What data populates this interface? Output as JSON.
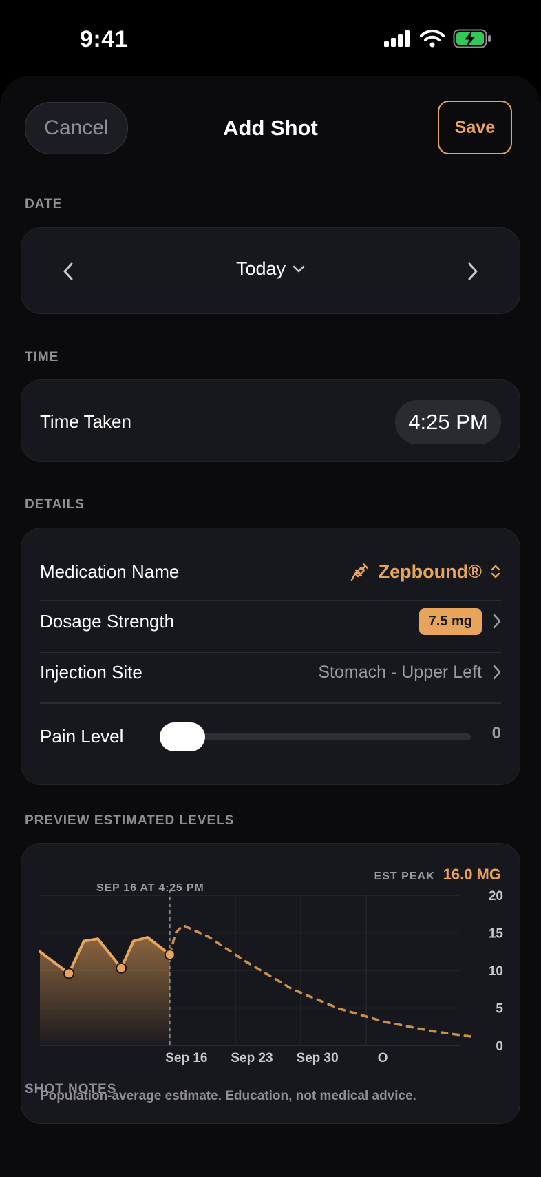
{
  "status": {
    "time": "9:41"
  },
  "nav": {
    "cancel": "Cancel",
    "title": "Add Shot",
    "save": "Save"
  },
  "sections": {
    "date": "DATE",
    "time": "TIME",
    "details": "DETAILS",
    "preview": "PREVIEW ESTIMATED LEVELS",
    "notes": "SHOT NOTES"
  },
  "date": {
    "value": "Today"
  },
  "time": {
    "label": "Time Taken",
    "value": "4:25 PM"
  },
  "details": {
    "medication": {
      "label": "Medication Name",
      "value": "Zepbound®"
    },
    "dosage": {
      "label": "Dosage Strength",
      "value": "7.5 mg"
    },
    "site": {
      "label": "Injection Site",
      "value": "Stomach - Upper Left"
    },
    "pain": {
      "label": "Pain Level",
      "value": "0"
    }
  },
  "chart": {
    "est_peak_label": "EST PEAK",
    "est_peak_value": "16.0 MG",
    "marker_label": "SEP 16 AT 4:25 PM",
    "disclaimer": "Population-average estimate. Education, not medical advice."
  },
  "colors": {
    "accent": "#e8a45a",
    "card": "#17181d",
    "background": "#0b0b0d"
  },
  "chart_data": {
    "type": "line",
    "title": "",
    "xlabel": "",
    "ylabel": "",
    "ylim": [
      0,
      20
    ],
    "yticks": [
      "0",
      "5",
      "10",
      "15",
      "20"
    ],
    "xticks": [
      "Sep 16",
      "Sep 23",
      "Sep 30",
      "O"
    ],
    "x_domain_days": [
      -7,
      39
    ],
    "grid": true,
    "series": [
      {
        "style": "solid-filled",
        "points": [
          [
            -7,
            12.5
          ],
          [
            -3.9,
            9.6
          ],
          [
            -2.3,
            13.9
          ],
          [
            -0.8,
            14.2
          ],
          [
            1.7,
            10.3
          ],
          [
            3.0,
            13.9
          ],
          [
            4.5,
            14.4
          ],
          [
            6.9,
            12.1
          ]
        ]
      },
      {
        "style": "dashed",
        "points": [
          [
            6.9,
            12.1
          ],
          [
            7.5,
            15.0
          ],
          [
            8.3,
            16.0
          ],
          [
            11,
            14.5
          ],
          [
            15,
            11.2
          ],
          [
            20,
            7.5
          ],
          [
            25,
            4.9
          ],
          [
            30,
            3.1
          ],
          [
            35,
            1.9
          ],
          [
            39,
            1.2
          ]
        ]
      }
    ],
    "dose_markers": [
      [
        -3.9,
        9.6
      ],
      [
        1.7,
        10.3
      ],
      [
        6.9,
        12.1
      ]
    ],
    "current_marker_day": 6.9
  }
}
